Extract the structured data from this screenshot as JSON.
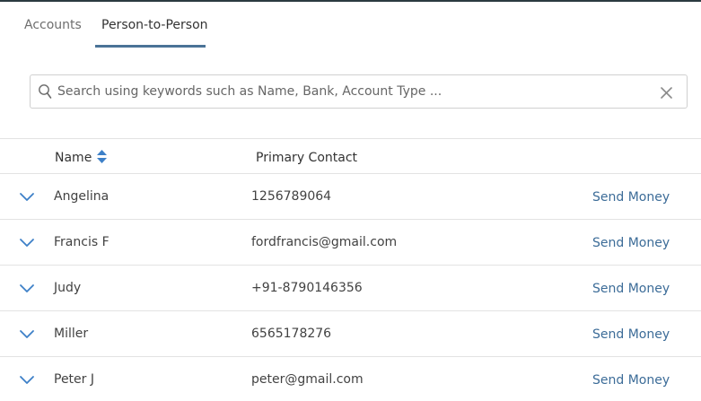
{
  "colors": {
    "accent": "#4a7397",
    "link": "#3c6c98",
    "icon_blue": "#3d80c8"
  },
  "tabs": [
    {
      "label": "Accounts",
      "active": false
    },
    {
      "label": "Person-to-Person",
      "active": true
    }
  ],
  "search": {
    "icon": "search-icon",
    "placeholder": "Search using keywords such as Name, Bank, Account Type ...",
    "value": "",
    "clear_icon": "close-icon"
  },
  "table": {
    "columns": [
      {
        "label": "Name",
        "sort_icon": "sort-icon"
      },
      {
        "label": "Primary Contact"
      }
    ],
    "rows": [
      {
        "name": "Angelina",
        "contact": "1256789064",
        "action": "Send Money"
      },
      {
        "name": "Francis F",
        "contact": "fordfrancis@gmail.com",
        "action": "Send Money"
      },
      {
        "name": "Judy",
        "contact": "+91-8790146356",
        "action": "Send Money"
      },
      {
        "name": "Miller",
        "contact": "6565178276",
        "action": "Send Money"
      },
      {
        "name": "Peter J",
        "contact": "peter@gmail.com",
        "action": "Send Money"
      }
    ]
  }
}
